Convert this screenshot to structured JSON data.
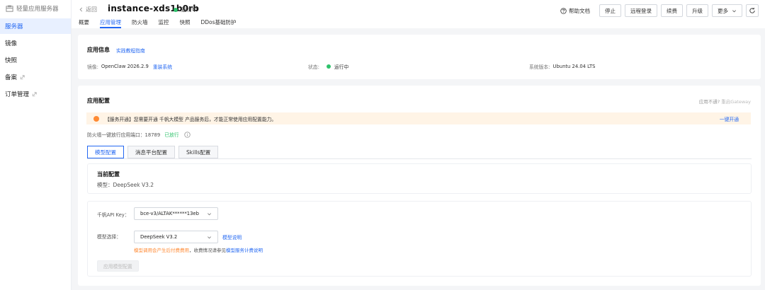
{
  "sidebar": {
    "brand": "轻量应用服务器",
    "items": [
      {
        "label": "服务器",
        "active": true
      },
      {
        "label": "镜像"
      },
      {
        "label": "快照"
      },
      {
        "label": "备案"
      },
      {
        "label": "订单管理"
      }
    ]
  },
  "header": {
    "back": "返回",
    "instance": "instance-xds1b0rb",
    "status": "运行中",
    "tabs": [
      "概要",
      "应用管理",
      "防火墙",
      "监控",
      "快照",
      "DDos基础防护"
    ],
    "actions": {
      "help": "帮助文档",
      "stop": "停止",
      "remote": "远程登录",
      "renew": "续费",
      "upgrade": "升级",
      "more": "更多"
    }
  },
  "app_info": {
    "title": "应用信息",
    "guide": "实践教程指南",
    "image_label": "镜像:",
    "image_value": "OpenClaw 2026.2.9",
    "reinstall": "重装系统",
    "status_label": "状态:",
    "status_value": "运行中",
    "os_label": "系统版本:",
    "os_value": "Ubuntu 24.04 LTS"
  },
  "app_config": {
    "title": "应用配置",
    "hint": "应用不通?",
    "hint_action": "重启Gateway",
    "banner_text": "【服务开通】您需要开通 千帆大模型 产品服务后，才能正常使用应用配置能力。",
    "banner_action": "一键开通",
    "firewall_text": "防火墙一键放行应用端口：18789",
    "firewall_status": "已放行",
    "tabs": [
      "模型配置",
      "消息平台配置",
      "Skills配置"
    ],
    "current": {
      "title": "当前配置",
      "model": "模型：DeepSeek V3.2"
    },
    "form": {
      "api_key_label": "千帆API Key：",
      "api_key_value": "bce-v3/ALTAK******13eb",
      "model_label": "模型选择：",
      "model_value": "DeepSeek V3.2",
      "model_help": "模型说明",
      "fee_warn": "模型调用会产生后付费费用",
      "fee_rest": "，收费情况请参见",
      "fee_link": "模型服务计费说明",
      "apply": "应用模型配置"
    }
  },
  "colors": {
    "accent": "#2468f2",
    "running": "#2ec26b",
    "warning": "#ff8a34",
    "banner_bg": "#fff4e6"
  }
}
